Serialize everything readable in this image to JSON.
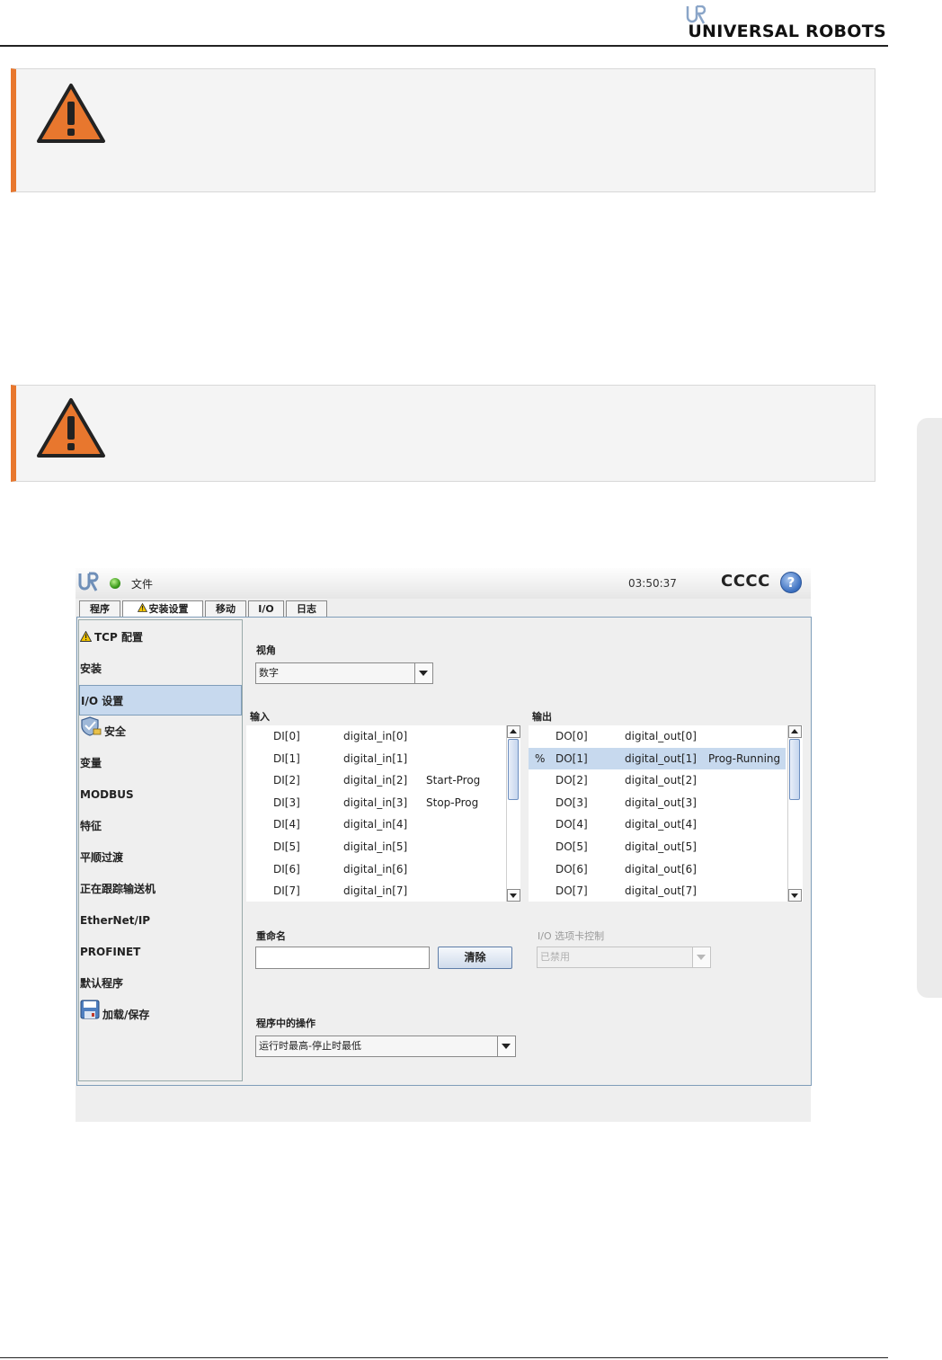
{
  "page": {
    "brand": "UNIVERSAL ROBOTS"
  },
  "app": {
    "topbar": {
      "file_menu": "文件",
      "clock": "03:50:37",
      "robot_name": "CCCC",
      "help": "?"
    },
    "tabs": [
      {
        "label": "程序"
      },
      {
        "label": "安装设置",
        "active": true,
        "warning": true
      },
      {
        "label": "移动"
      },
      {
        "label": "I/O"
      },
      {
        "label": "日志"
      }
    ],
    "sidebar": [
      {
        "label": "TCP 配置",
        "icon": "warning-icon"
      },
      {
        "label": "安装"
      },
      {
        "label": "I/O 设置",
        "selected": true
      },
      {
        "label": "安全",
        "icon": "shield-icon"
      },
      {
        "label": "变量"
      },
      {
        "label": "MODBUS"
      },
      {
        "label": "特征"
      },
      {
        "label": "平顺过渡"
      },
      {
        "label": "正在跟踪输送机"
      },
      {
        "label": "EtherNet/IP"
      },
      {
        "label": "PROFINET"
      },
      {
        "label": "默认程序"
      },
      {
        "label": "加载/保存",
        "icon": "save-icon"
      }
    ],
    "view": {
      "label": "视角",
      "selected": "数字"
    },
    "inputs": {
      "label": "输入",
      "rows": [
        {
          "id": "DI[0]",
          "name": "digital_in[0]",
          "func": ""
        },
        {
          "id": "DI[1]",
          "name": "digital_in[1]",
          "func": ""
        },
        {
          "id": "DI[2]",
          "name": "digital_in[2]",
          "func": "Start-Prog"
        },
        {
          "id": "DI[3]",
          "name": "digital_in[3]",
          "func": "Stop-Prog"
        },
        {
          "id": "DI[4]",
          "name": "digital_in[4]",
          "func": ""
        },
        {
          "id": "DI[5]",
          "name": "digital_in[5]",
          "func": ""
        },
        {
          "id": "DI[6]",
          "name": "digital_in[6]",
          "func": ""
        },
        {
          "id": "DI[7]",
          "name": "digital_in[7]",
          "func": ""
        }
      ]
    },
    "outputs": {
      "label": "输出",
      "rows": [
        {
          "mark": "",
          "id": "DO[0]",
          "name": "digital_out[0]",
          "func": ""
        },
        {
          "mark": "%",
          "id": "DO[1]",
          "name": "digital_out[1]",
          "func": "Prog-Running",
          "selected": true
        },
        {
          "mark": "",
          "id": "DO[2]",
          "name": "digital_out[2]",
          "func": ""
        },
        {
          "mark": "",
          "id": "DO[3]",
          "name": "digital_out[3]",
          "func": ""
        },
        {
          "mark": "",
          "id": "DO[4]",
          "name": "digital_out[4]",
          "func": ""
        },
        {
          "mark": "",
          "id": "DO[5]",
          "name": "digital_out[5]",
          "func": ""
        },
        {
          "mark": "",
          "id": "DO[6]",
          "name": "digital_out[6]",
          "func": ""
        },
        {
          "mark": "",
          "id": "DO[7]",
          "name": "digital_out[7]",
          "func": ""
        }
      ]
    },
    "rename": {
      "label": "重命名",
      "value": "",
      "clear_button": "清除"
    },
    "tab_control": {
      "label": "I/O 选项卡控制",
      "selected": "已禁用"
    },
    "action": {
      "label": "程序中的操作",
      "selected": "运行时最高-停止时最低"
    }
  },
  "colors": {
    "warning_accent": "#e8772e",
    "selection": "#c7d9ee"
  }
}
